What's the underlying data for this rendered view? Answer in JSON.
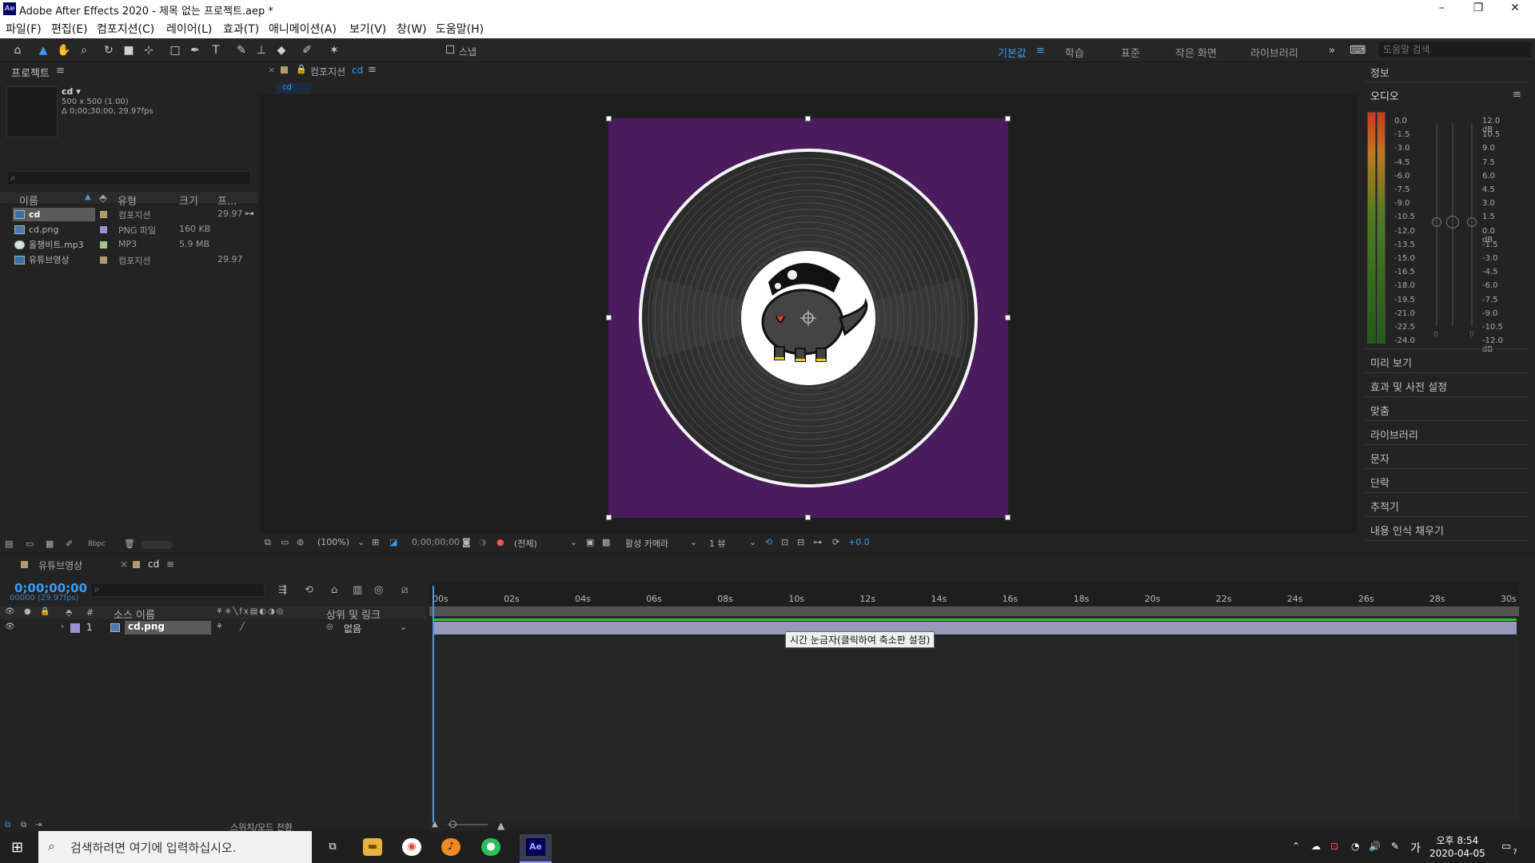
{
  "window": {
    "title": "Adobe After Effects 2020 - 제목 없는 프로젝트.aep *",
    "app_icon": "Ae"
  },
  "menu": [
    "파일(F)",
    "편집(E)",
    "컴포지션(C)",
    "레이어(L)",
    "효과(T)",
    "애니메이션(A)",
    "보기(V)",
    "창(W)",
    "도움말(H)"
  ],
  "toolbar": {
    "snap_label": "스냅",
    "workspaces": [
      "기본값",
      "학습",
      "표준",
      "작은 화면",
      "라이브러리"
    ],
    "active_workspace": "기본값",
    "more": "»",
    "help_search_placeholder": "도움말 검색"
  },
  "project": {
    "title": "프로젝트",
    "comp_name": "cd ▾",
    "comp_size": "500 x 500 (1.00)",
    "comp_duration": "Δ 0;00;30;00, 29.97fps",
    "search_icon": "⌕",
    "columns": [
      "이름",
      "유형",
      "크기",
      "프..."
    ],
    "items": [
      {
        "name": "cd",
        "type": "컴포지션",
        "size": "",
        "fps": "29.97",
        "swatch": "#b59a6e",
        "selected": true
      },
      {
        "name": "cd.png",
        "type": "PNG 파일",
        "size": "160 KB",
        "fps": "",
        "swatch": "#9c8fd2",
        "selected": false
      },
      {
        "name": "올챙비트.mp3",
        "type": "MP3",
        "size": "5.9 MB",
        "fps": "",
        "swatch": "#a6c48f",
        "selected": false
      },
      {
        "name": "유튜브영상",
        "type": "컴포지션",
        "size": "",
        "fps": "29.97",
        "swatch": "#b59a6e",
        "selected": false
      }
    ],
    "bpc": "8bpc"
  },
  "viewer": {
    "tab_title": "컴포지션",
    "tab_comp": "cd",
    "breadcrumb": "cd",
    "zoom": "(100%)",
    "timecode": "0;00;00;00",
    "resolution": "(전체)",
    "camera": "활성 카메라",
    "views": "1 뷰",
    "exposure": "+0.0"
  },
  "right_panel": {
    "info": "정보",
    "audio": "오디오",
    "sections": [
      "미리 보기",
      "효과 및 사전 설정",
      "맞춤",
      "라이브러리",
      "문자",
      "단락",
      "추적기",
      "내용 인식 채우기"
    ],
    "left_scale": [
      "0.0",
      "-1.5",
      "-3.0",
      "-4.5",
      "-6.0",
      "-7.5",
      "-9.0",
      "-10.5",
      "-12.0",
      "-13.5",
      "-15.0",
      "-16.5",
      "-18.0",
      "-19.5",
      "-21.0",
      "-22.5",
      "-24.0"
    ],
    "right_scale": [
      "12.0 dB",
      "10.5",
      "9.0",
      "7.5",
      "6.0",
      "4.5",
      "3.0",
      "1.5",
      "0.0 dB",
      "-1.5",
      "-3.0",
      "-4.5",
      "-6.0",
      "-7.5",
      "-9.0",
      "-10.5",
      "-12.0 dB"
    ],
    "slider_zero": "0"
  },
  "timeline": {
    "tabs": [
      "유튜브영상",
      "cd"
    ],
    "active_tab": "cd",
    "timecode": "0;00;00;00",
    "timecode_sub": "00000 (29.97fps)",
    "layer_columns": [
      "#",
      "소스 이름",
      "상위 및 링크"
    ],
    "layers": [
      {
        "index": "1",
        "name": "cd.png",
        "parent": "없음"
      }
    ],
    "ticks": [
      "00s",
      "02s",
      "04s",
      "06s",
      "08s",
      "10s",
      "12s",
      "14s",
      "16s",
      "18s",
      "20s",
      "22s",
      "24s",
      "26s",
      "28s",
      "30s"
    ],
    "tooltip": "시간 눈금자(클릭하여 축소판 설정)",
    "footer": "스위치/모드 전환"
  },
  "taskbar": {
    "search_placeholder": "검색하려면 여기에 입력하십시오.",
    "ime": "가",
    "time": "오후 8:54",
    "date": "2020-04-05",
    "notifications": "7"
  },
  "colors": {
    "accent": "#3c9cf2",
    "comp_background": "#4a1c5e",
    "audio_green": "#2fbf2f"
  }
}
